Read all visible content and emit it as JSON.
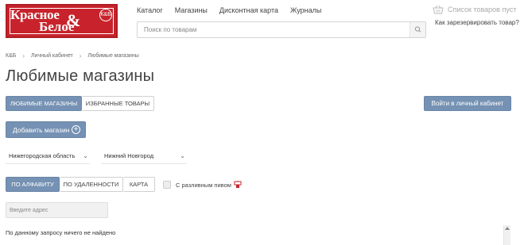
{
  "logo": {
    "word1": "Красное",
    "ampersand": "&",
    "word2": "Белое",
    "badge": "К&Б"
  },
  "nav": {
    "items": [
      "Каталог",
      "Магазины",
      "Дисконтная карта",
      "Журналы"
    ]
  },
  "search": {
    "placeholder": "Поиск по товарам"
  },
  "cart": {
    "label": "Список товаров пуст"
  },
  "reserve_link": "Как зарезервировать товар?",
  "breadcrumb": [
    "К&Б",
    "Личный кабинет",
    "Любимые магазины"
  ],
  "page_title": "Любимые магазины",
  "tabs": {
    "favorites": "ЛЮБИМЫЕ МАГАЗИНЫ",
    "selected": "ИЗБРАННЫЕ ТОВАРЫ"
  },
  "login_button": "Войти в личный кабинет",
  "add_shop_button": "Добавить магазин",
  "filters": {
    "region": "Нижегородская область",
    "city": "Нижний Новгород"
  },
  "sort_tabs": {
    "alphabet": "ПО АЛФАВИТУ",
    "distance": "ПО УДАЛЕННОСТИ",
    "map": "КАРТА"
  },
  "draft_beer_label": "С разливным пивом",
  "address": {
    "placeholder": "Введите адрес"
  },
  "empty_result": "По данному запросу ничего не найдено",
  "colors": {
    "brand_red": "#c8232c",
    "accent_blue": "#7591b3"
  }
}
